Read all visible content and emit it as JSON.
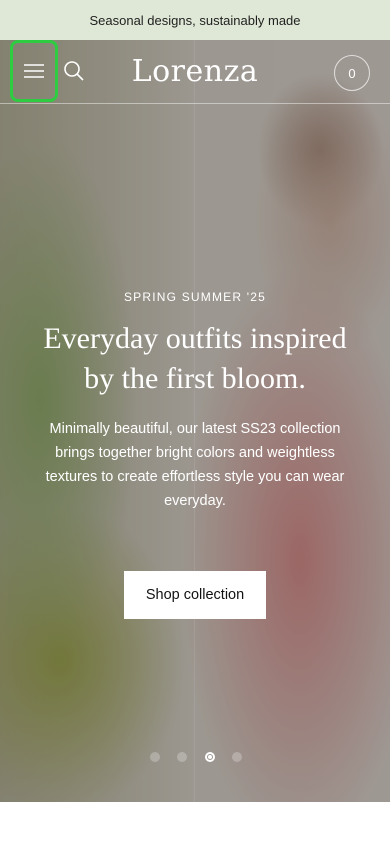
{
  "announcement": {
    "text": "Seasonal designs, sustainably made"
  },
  "header": {
    "logo": "Lorenza",
    "menu_icon": "hamburger-menu-icon",
    "search_icon": "search-icon",
    "cart_count": "0"
  },
  "hero": {
    "eyebrow": "SPRING SUMMER '25",
    "headline": "Everyday outfits inspired by the first bloom.",
    "subtext": "Minimally beautiful, our latest SS23 collection brings together bright colors and weightless textures to create effortless style you can wear everyday.",
    "cta_label": "Shop collection",
    "slides_total": 4,
    "active_slide": 3
  },
  "colors": {
    "announcement_bg": "#dfe8d6",
    "highlight_border": "#2ecc40",
    "text_on_hero": "#ffffff"
  }
}
